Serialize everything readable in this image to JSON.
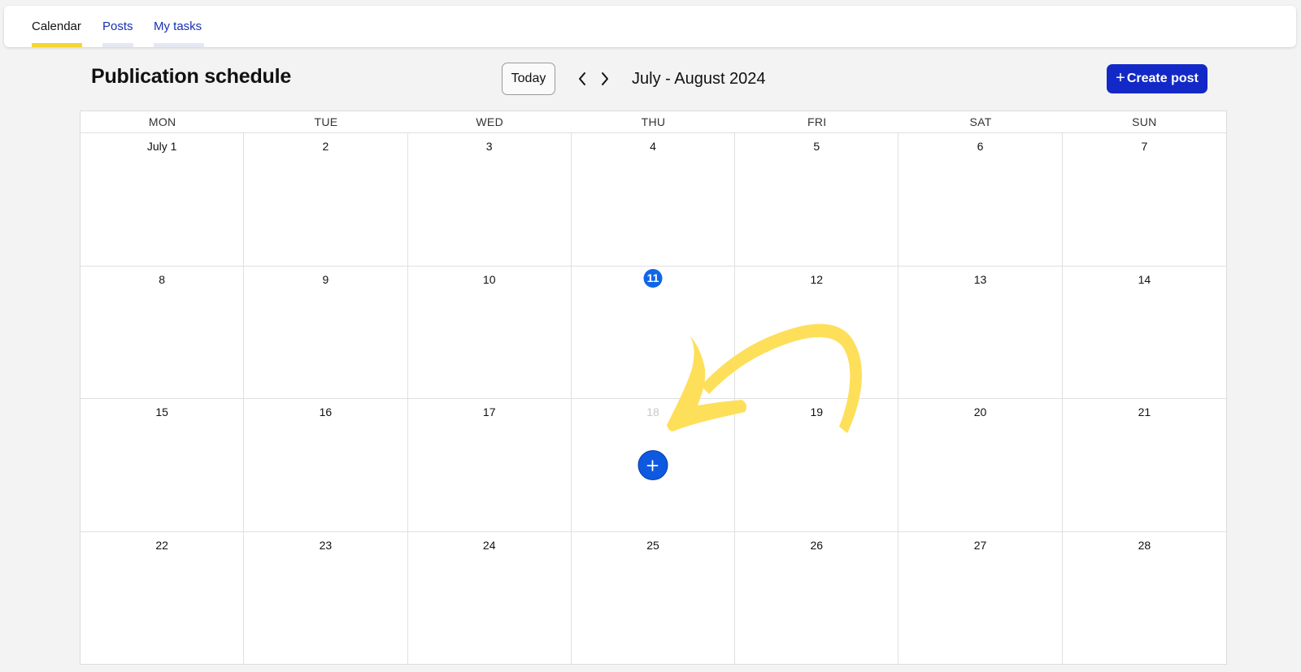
{
  "tabs": [
    {
      "label": "Calendar",
      "active": true
    },
    {
      "label": "Posts",
      "active": false
    },
    {
      "label": "My tasks",
      "active": false
    }
  ],
  "header": {
    "title": "Publication schedule",
    "today_label": "Today",
    "prev_icon": "chevron-left-icon",
    "next_icon": "chevron-right-icon",
    "range_label": "July - August 2024",
    "create_label": "Create post",
    "create_icon": "plus-icon"
  },
  "colors": {
    "accent": "#1329c7",
    "today": "#0f66e8",
    "tab_indicator": "#f6d630",
    "annotation_arrow": "#fedf5a"
  },
  "calendar": {
    "weekdays": [
      "MON",
      "TUE",
      "WED",
      "THU",
      "FRI",
      "SAT",
      "SUN"
    ],
    "weeks": [
      [
        {
          "label": "July 1"
        },
        {
          "label": "2"
        },
        {
          "label": "3"
        },
        {
          "label": "4"
        },
        {
          "label": "5"
        },
        {
          "label": "6"
        },
        {
          "label": "7"
        }
      ],
      [
        {
          "label": "8"
        },
        {
          "label": "9"
        },
        {
          "label": "10"
        },
        {
          "label": "11",
          "today": true
        },
        {
          "label": "12"
        },
        {
          "label": "13"
        },
        {
          "label": "14"
        }
      ],
      [
        {
          "label": "15"
        },
        {
          "label": "16"
        },
        {
          "label": "17"
        },
        {
          "label": "18",
          "muted": true,
          "add_button": true
        },
        {
          "label": "19"
        },
        {
          "label": "20"
        },
        {
          "label": "21"
        }
      ],
      [
        {
          "label": "22"
        },
        {
          "label": "23"
        },
        {
          "label": "24"
        },
        {
          "label": "25"
        },
        {
          "label": "26"
        },
        {
          "label": "27"
        },
        {
          "label": "28"
        }
      ]
    ],
    "add_icon": "plus-icon"
  },
  "annotation": {
    "type": "hand-drawn-arrow",
    "points_to": "add-post-button"
  }
}
